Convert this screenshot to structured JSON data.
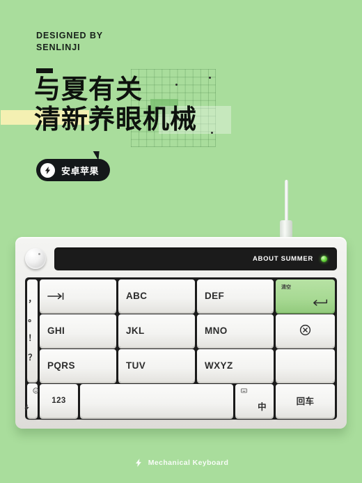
{
  "theme": {
    "background": "#a9dd9c",
    "case": "#f0efed",
    "plate": "#1d1d1d",
    "accent_green": "#a7d993",
    "highlight_yellow": "#f4f0b2",
    "ink": "#0e120e"
  },
  "hero": {
    "designed_by": "DESIGNED BY\nSENLINJI",
    "headline_line1": "与夏有关",
    "headline_line2": "清新养眼机械",
    "badge_label": "安卓苹果"
  },
  "keyboard": {
    "screen_label": "ABOUT SUMMER",
    "keys": {
      "punctuation": [
        "，",
        "。",
        "！",
        "？"
      ],
      "tab": "⇥",
      "abc": "ABC",
      "def": "DEF",
      "clear_top": "清空",
      "clear_arrow": "↵",
      "ghi": "GHI",
      "jkl": "JKL",
      "mno": "MNO",
      "delete": "⊗",
      "pqrs": "PQRS",
      "tuv": "TUV",
      "wxyz": "WXYZ",
      "emoji": "☻",
      "bolt": "⚡",
      "num": "123",
      "space": "",
      "lang_top": "⌨",
      "lang": "中",
      "enter": "回车"
    }
  },
  "footer": {
    "brand": "Mechanical Keyboard"
  }
}
